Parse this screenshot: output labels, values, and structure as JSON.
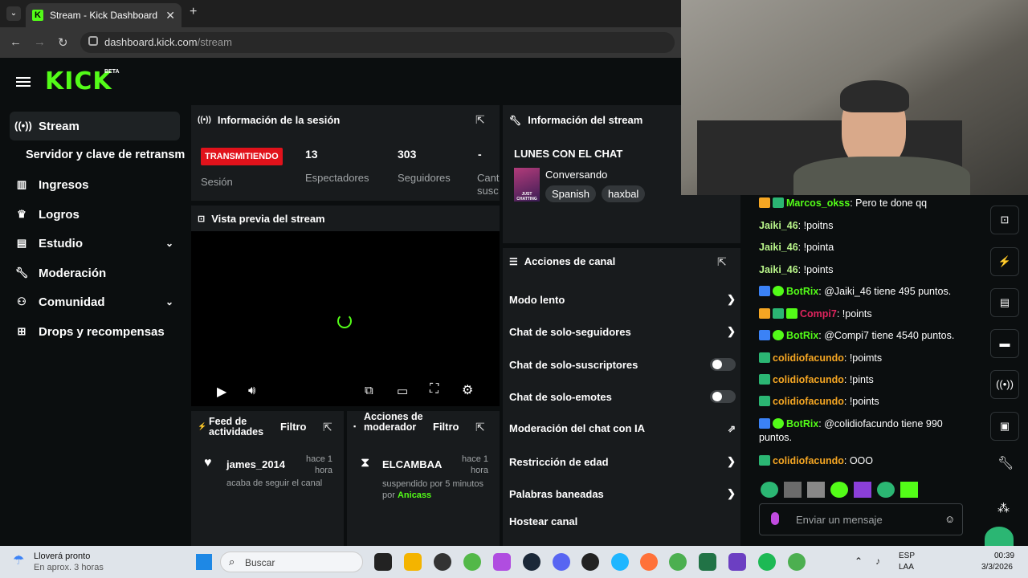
{
  "browser": {
    "tab_title": "Stream - Kick Dashboard",
    "url_host": "dashboard.kick.com",
    "url_path": "/stream"
  },
  "header": {
    "logo": "KICK",
    "beta": "BETA"
  },
  "sidebar": {
    "items": [
      {
        "label": "Stream",
        "icon": "broadcast-icon"
      },
      {
        "label": "Servidor y clave de retransm",
        "icon": ""
      },
      {
        "label": "Ingresos",
        "icon": "chart-icon"
      },
      {
        "label": "Logros",
        "icon": "trophy-icon"
      },
      {
        "label": "Estudio",
        "icon": "studio-icon"
      },
      {
        "label": "Moderación",
        "icon": "wrench-icon"
      },
      {
        "label": "Comunidad",
        "icon": "people-icon"
      },
      {
        "label": "Drops y recompensas",
        "icon": "gift-icon"
      }
    ]
  },
  "session": {
    "title": "Información de la sesión",
    "live_badge": "TRANSMITIENDO",
    "session_label": "Sesión",
    "viewers": "13",
    "viewers_label": "Espectadores",
    "followers": "303",
    "followers_label": "Seguidores",
    "subs": "-",
    "subs_label": "Cant susc"
  },
  "preview": {
    "title": "Vista previa del stream"
  },
  "activity": {
    "title": "Feed de actividades",
    "filter": "Filtro",
    "user": "james_2014",
    "time": "hace 1 hora",
    "text": "acaba de seguir el canal"
  },
  "modactions": {
    "title": "Acciones de moderador",
    "filter": "Filtro",
    "user": "ELCAMBAA",
    "time": "hace 1 hora",
    "text": "suspendido por 5 minutos por",
    "by": "Anicass"
  },
  "streaminfo": {
    "title": "Información del stream",
    "stream_title": "LUNES CON EL CHAT",
    "category": "Conversando",
    "tags": [
      "Spanish",
      "haxbal"
    ],
    "thumb_text": "JUST CHATTING"
  },
  "channel_actions": {
    "title": "Acciones de canal",
    "items": [
      {
        "label": "Modo lento",
        "type": "chevron"
      },
      {
        "label": "Chat de solo-seguidores",
        "type": "chevron"
      },
      {
        "label": "Chat de solo-suscriptores",
        "type": "toggle"
      },
      {
        "label": "Chat de solo-emotes",
        "type": "toggle"
      },
      {
        "label": "Moderación del chat con IA",
        "type": "external"
      },
      {
        "label": "Restricción de edad",
        "type": "chevron"
      },
      {
        "label": "Palabras baneadas",
        "type": "chevron"
      },
      {
        "label": "Hostear canal",
        "type": "none"
      }
    ]
  },
  "chat": {
    "messages": [
      {
        "user": "Marcos_okss",
        "color": "#53fc18",
        "text": ": Pero te done qq"
      },
      {
        "user": "Jaiki_46",
        "color": "#b9f58a",
        "text": ": !poitns"
      },
      {
        "user": "Jaiki_46",
        "color": "#b9f58a",
        "text": ": !pointa"
      },
      {
        "user": "Jaiki_46",
        "color": "#b9f58a",
        "text": ": !points"
      },
      {
        "user": "BotRix",
        "color": "#53fc18",
        "text": ": @Jaiki_46 tiene 495 puntos."
      },
      {
        "user": "Compi7",
        "color": "#e0245e",
        "text": ": !points"
      },
      {
        "user": "BotRix",
        "color": "#53fc18",
        "text": ": @Compi7 tiene 4540 puntos."
      },
      {
        "user": "colidiofacundo",
        "color": "#f5a623",
        "text": ": !poimts"
      },
      {
        "user": "colidiofacundo",
        "color": "#f5a623",
        "text": ": !pints"
      },
      {
        "user": "colidiofacundo",
        "color": "#f5a623",
        "text": ": !points"
      },
      {
        "user": "BotRix",
        "color": "#53fc18",
        "text": ": @colidiofacundo tiene 990 puntos."
      },
      {
        "user": "colidiofacundo",
        "color": "#f5a623",
        "text": ": OOO"
      }
    ],
    "placeholder": "Enviar un mensaje"
  },
  "taskbar": {
    "weather_title": "Lloverá pronto",
    "weather_sub": "En aprox. 3 horas",
    "search": "Buscar",
    "lang": "ESP",
    "lang2": "LAA",
    "time": "00:39",
    "date": "3/3/2026"
  }
}
